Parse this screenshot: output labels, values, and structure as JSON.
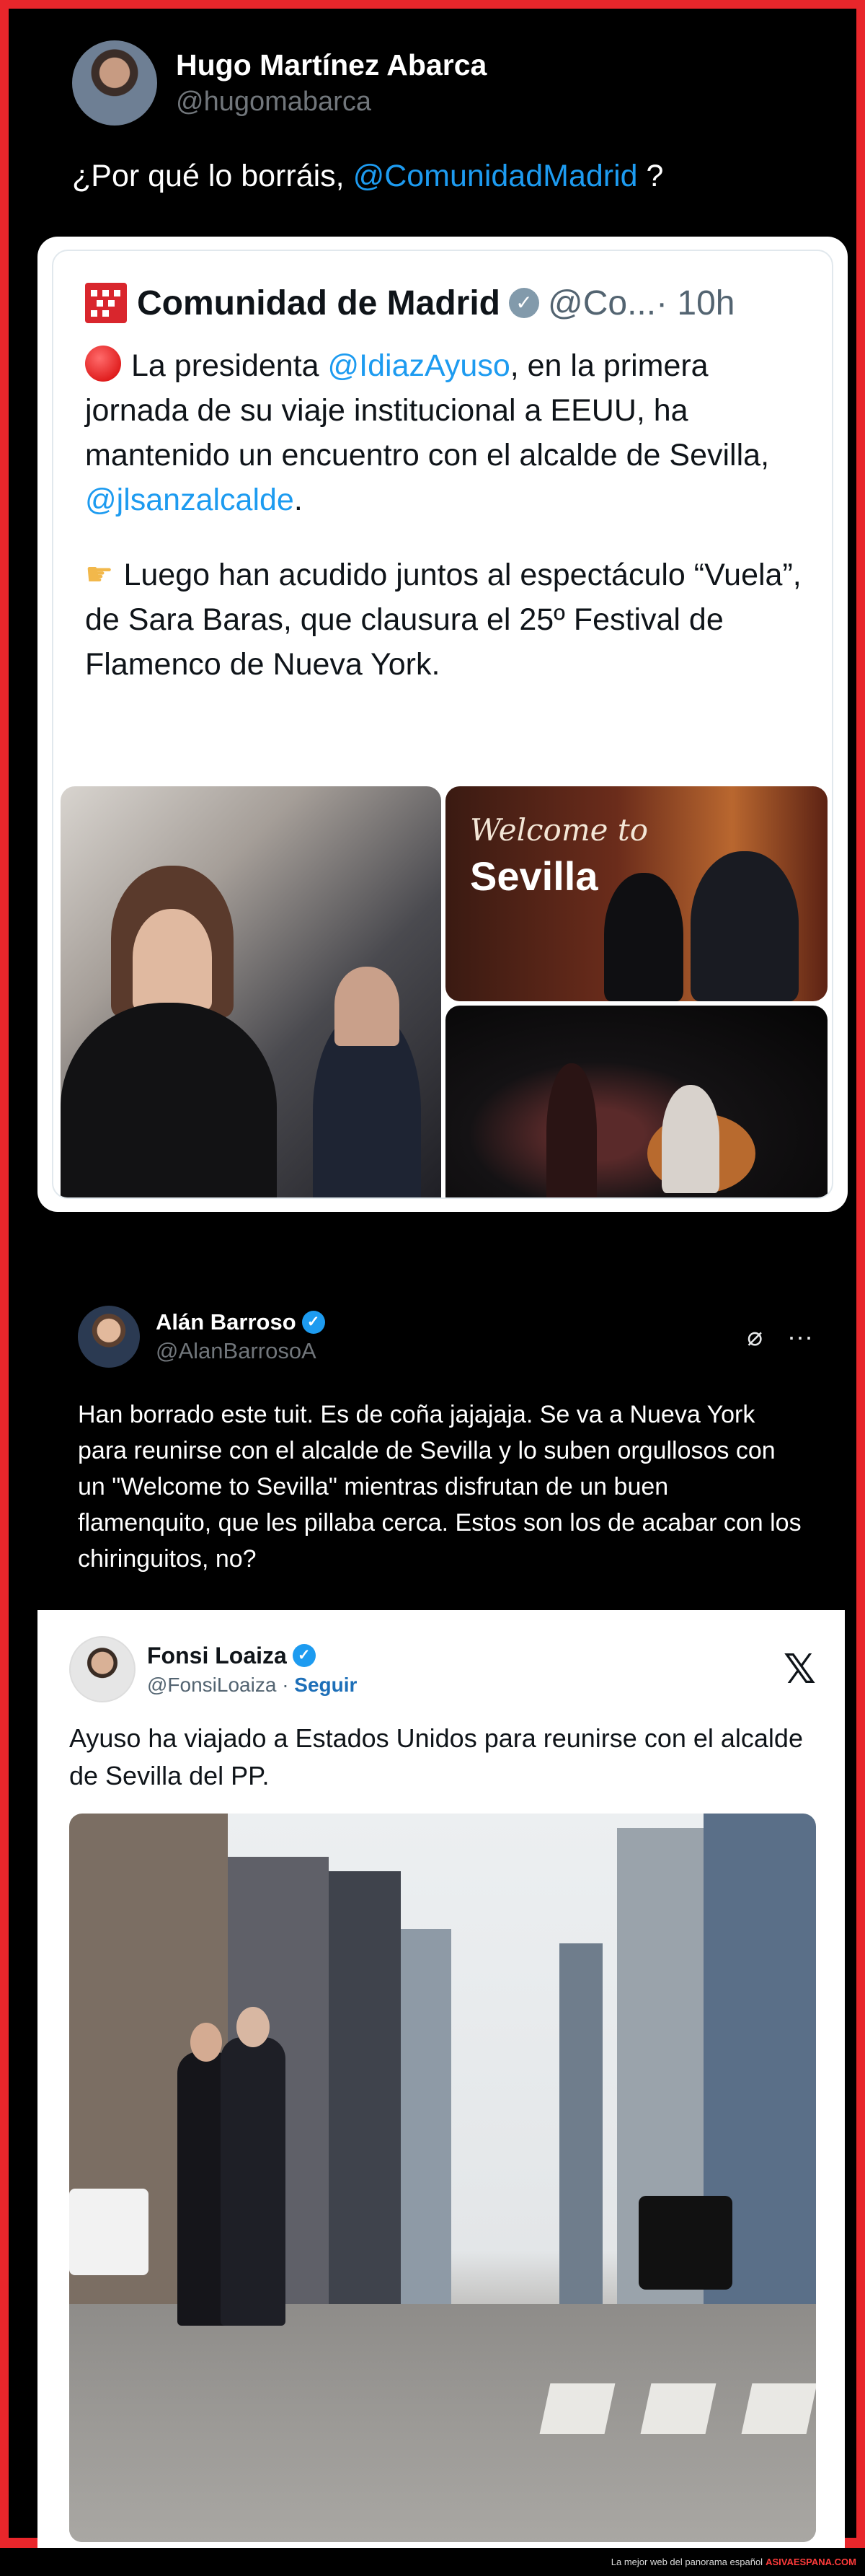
{
  "post1": {
    "author_name": "Hugo Martínez Abarca",
    "author_handle": "@hugomabarca",
    "text_before": "¿Por qué lo borráis, ",
    "mention": "@ComunidadMadrid",
    "text_after": " ?",
    "quoted": {
      "account_name": "Comunidad de Madrid",
      "handle_short": "@Co...",
      "time": "· 10h",
      "p1_before": "La presidenta ",
      "p1_mention1": "@IdiazAyuso",
      "p1_middle": ", en la primera jornada de su viaje institucional a EEUU, ha mantenido un encuentro con el alcalde de Sevilla, ",
      "p1_mention2": "@jlsanzalcalde",
      "p1_end": ".",
      "p2": "Luego han acudido juntos al espectáculo “Vuela”, de Sara Baras, que clausura el 25º Festival de Flamenco de Nueva York.",
      "photo_text_script": "Welcome to",
      "photo_text_big": "Sevilla"
    }
  },
  "post2": {
    "author_name": "Alán Barroso",
    "author_handle": "@AlanBarrosoA",
    "text": "Han borrado este tuit. Es de coña jajajaja. Se va a Nueva York para reunirse con el alcalde de Sevilla y lo suben orgullosos con un \"Welcome to Sevilla\" mientras disfrutan de un buen flamenquito, que les pillaba cerca. Estos son los de acabar con los chiringuitos, no?",
    "icons": [
      "grok-icon",
      "more-icon"
    ],
    "embedded": {
      "author_name": "Fonsi Loaiza",
      "author_handle": "@FonsiLoaiza",
      "separator": "·",
      "follow_label": "Seguir",
      "platform_logo": "𝕏",
      "text": "Ayuso ha viajado a Estados Unidos para reunirse con el alcalde de Sevilla del PP."
    }
  },
  "footer": {
    "tagline": "La mejor web del panorama español",
    "brand": "ASIVAESPANA.COM"
  },
  "colors": {
    "border_red": "#e8262b",
    "link_blue": "#1d9bf0",
    "background": "#000000"
  }
}
